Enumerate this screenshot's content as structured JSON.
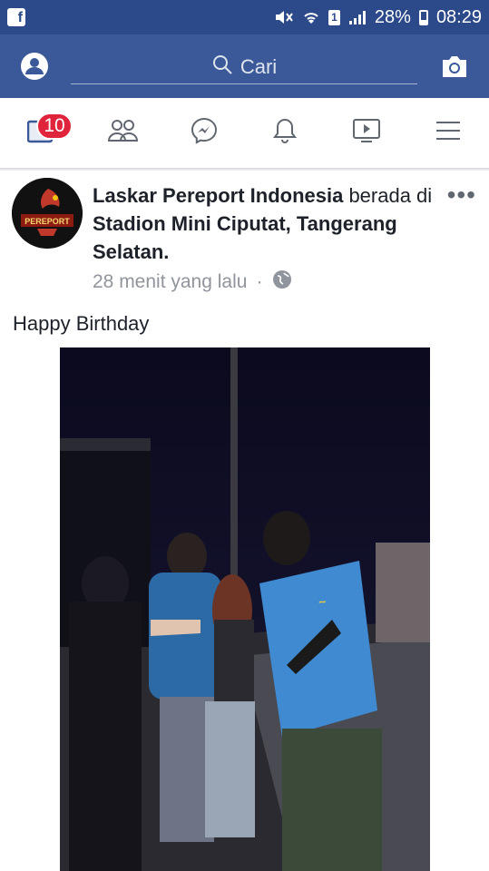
{
  "status_bar": {
    "app_icon": "facebook-f",
    "battery": "28%",
    "time": "08:29",
    "sim": "1"
  },
  "search": {
    "placeholder": "Cari",
    "left_icon": "profile-icon",
    "right_icon": "camera-icon"
  },
  "tabs": {
    "notifications_badge": "10",
    "items": [
      "news-feed",
      "friends",
      "messenger",
      "notifications",
      "video",
      "menu"
    ]
  },
  "post": {
    "author": "Laskar Pereport Indonesia",
    "connector": " berada di ",
    "location": "Stadion Mini Ciputat, Tangerang Selatan.",
    "time": "28 menit yang lalu",
    "separator": "·",
    "privacy_icon": "globe-icon",
    "caption": "Happy Birthday",
    "avatar_text": "PEREPORT"
  },
  "colors": {
    "status_bar": "#2c4a8a",
    "header": "#3b5998",
    "badge": "#e0243b",
    "text": "#1d2129",
    "meta": "#90949c"
  }
}
